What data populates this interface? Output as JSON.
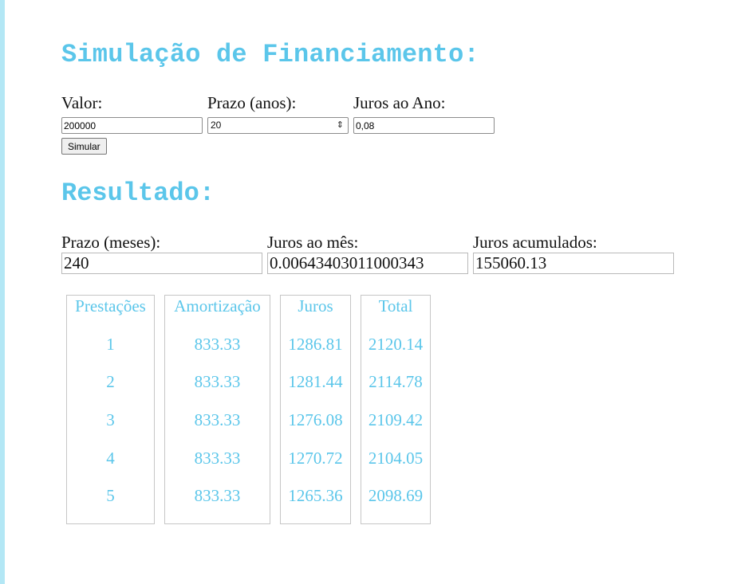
{
  "page": {
    "title": "Simulação de Financiamento:",
    "results_title": "Resultado:"
  },
  "form": {
    "valor_label": "Valor:",
    "valor_value": "200000",
    "prazo_label": "Prazo (anos):",
    "prazo_value": "20",
    "juros_label": "Juros ao Ano:",
    "juros_value": "0,08",
    "simular_label": "Simular"
  },
  "results": {
    "prazo_meses_label": "Prazo (meses):",
    "prazo_meses_value": "240",
    "juros_mes_label": "Juros ao mês:",
    "juros_mes_value": "0.00643403011000343",
    "juros_acumulados_label": "Juros acumulados:",
    "juros_acumulados_value": "155060.13"
  },
  "table": {
    "headers": [
      "Prestações",
      "Amortização",
      "Juros",
      "Total"
    ],
    "rows": [
      {
        "n": "1",
        "amortizacao": "833.33",
        "juros": "1286.81",
        "total": "2120.14"
      },
      {
        "n": "2",
        "amortizacao": "833.33",
        "juros": "1281.44",
        "total": "2114.78"
      },
      {
        "n": "3",
        "amortizacao": "833.33",
        "juros": "1276.08",
        "total": "2109.42"
      },
      {
        "n": "4",
        "amortizacao": "833.33",
        "juros": "1270.72",
        "total": "2104.05"
      },
      {
        "n": "5",
        "amortizacao": "833.33",
        "juros": "1265.36",
        "total": "2098.69"
      }
    ]
  },
  "colors": {
    "accent": "#5bc6ea",
    "left_bar": "#b3e7f5"
  },
  "icons": {
    "select_arrow": "chevron-up-down-icon"
  }
}
